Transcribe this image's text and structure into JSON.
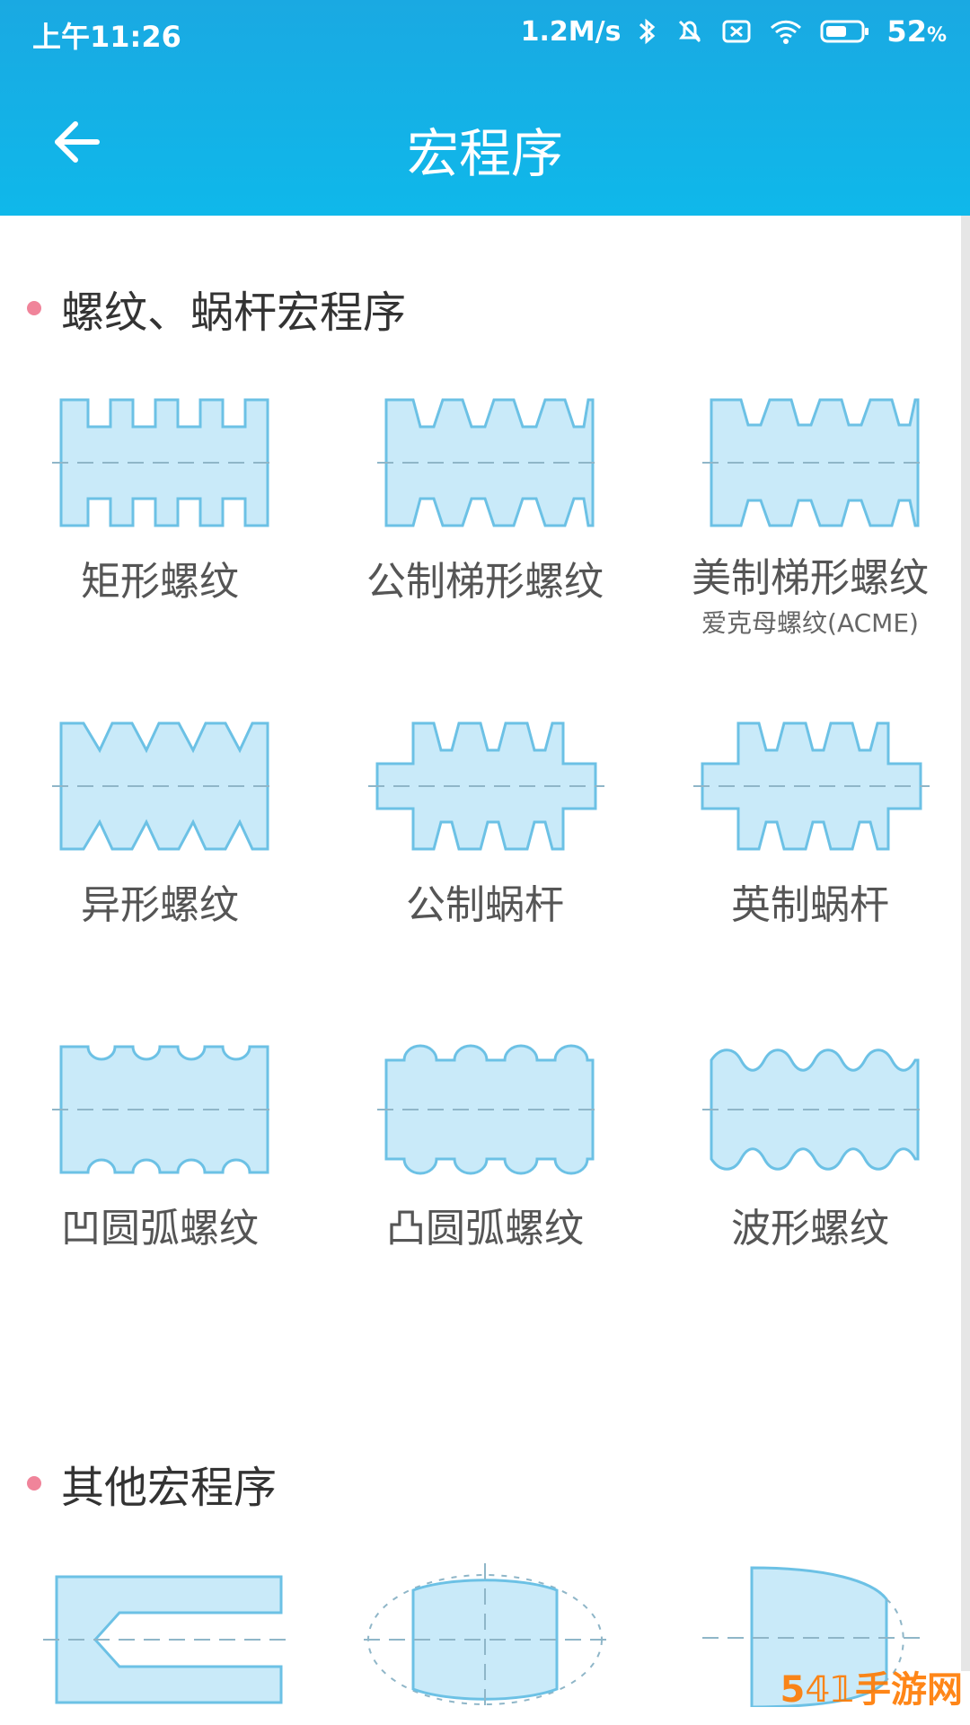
{
  "status_bar": {
    "time": "上午11:26",
    "network_speed": "1.2M/s",
    "battery": "52",
    "battery_unit": "%"
  },
  "header": {
    "title": "宏程序"
  },
  "sections": [
    {
      "title": "螺纹、蜗杆宏程序",
      "items": [
        {
          "label": "矩形螺纹",
          "icon": "rectangular-thread-icon"
        },
        {
          "label": "公制梯形螺纹",
          "icon": "metric-trapezoidal-thread-icon"
        },
        {
          "label": "美制梯形螺纹",
          "sub": "爱克母螺纹(ACME)",
          "icon": "acme-thread-icon"
        },
        {
          "label": "异形螺纹",
          "icon": "special-thread-icon"
        },
        {
          "label": "公制蜗杆",
          "icon": "metric-worm-icon"
        },
        {
          "label": "英制蜗杆",
          "icon": "imperial-worm-icon"
        },
        {
          "label": "凹圆弧螺纹",
          "icon": "concave-arc-thread-icon"
        },
        {
          "label": "凸圆弧螺纹",
          "icon": "convex-arc-thread-icon"
        },
        {
          "label": "波形螺纹",
          "icon": "wave-thread-icon"
        }
      ]
    },
    {
      "title": "其他宏程序",
      "items": [
        {
          "icon": "groove-shape-icon"
        },
        {
          "icon": "ellipse-barrel-icon"
        },
        {
          "icon": "ellipse-end-icon"
        }
      ]
    }
  ],
  "colors": {
    "appbar": "#12b0e6",
    "dot": "#f0849a",
    "shape_fill": "#c9eaf9",
    "shape_stroke": "#6cc1e5"
  }
}
